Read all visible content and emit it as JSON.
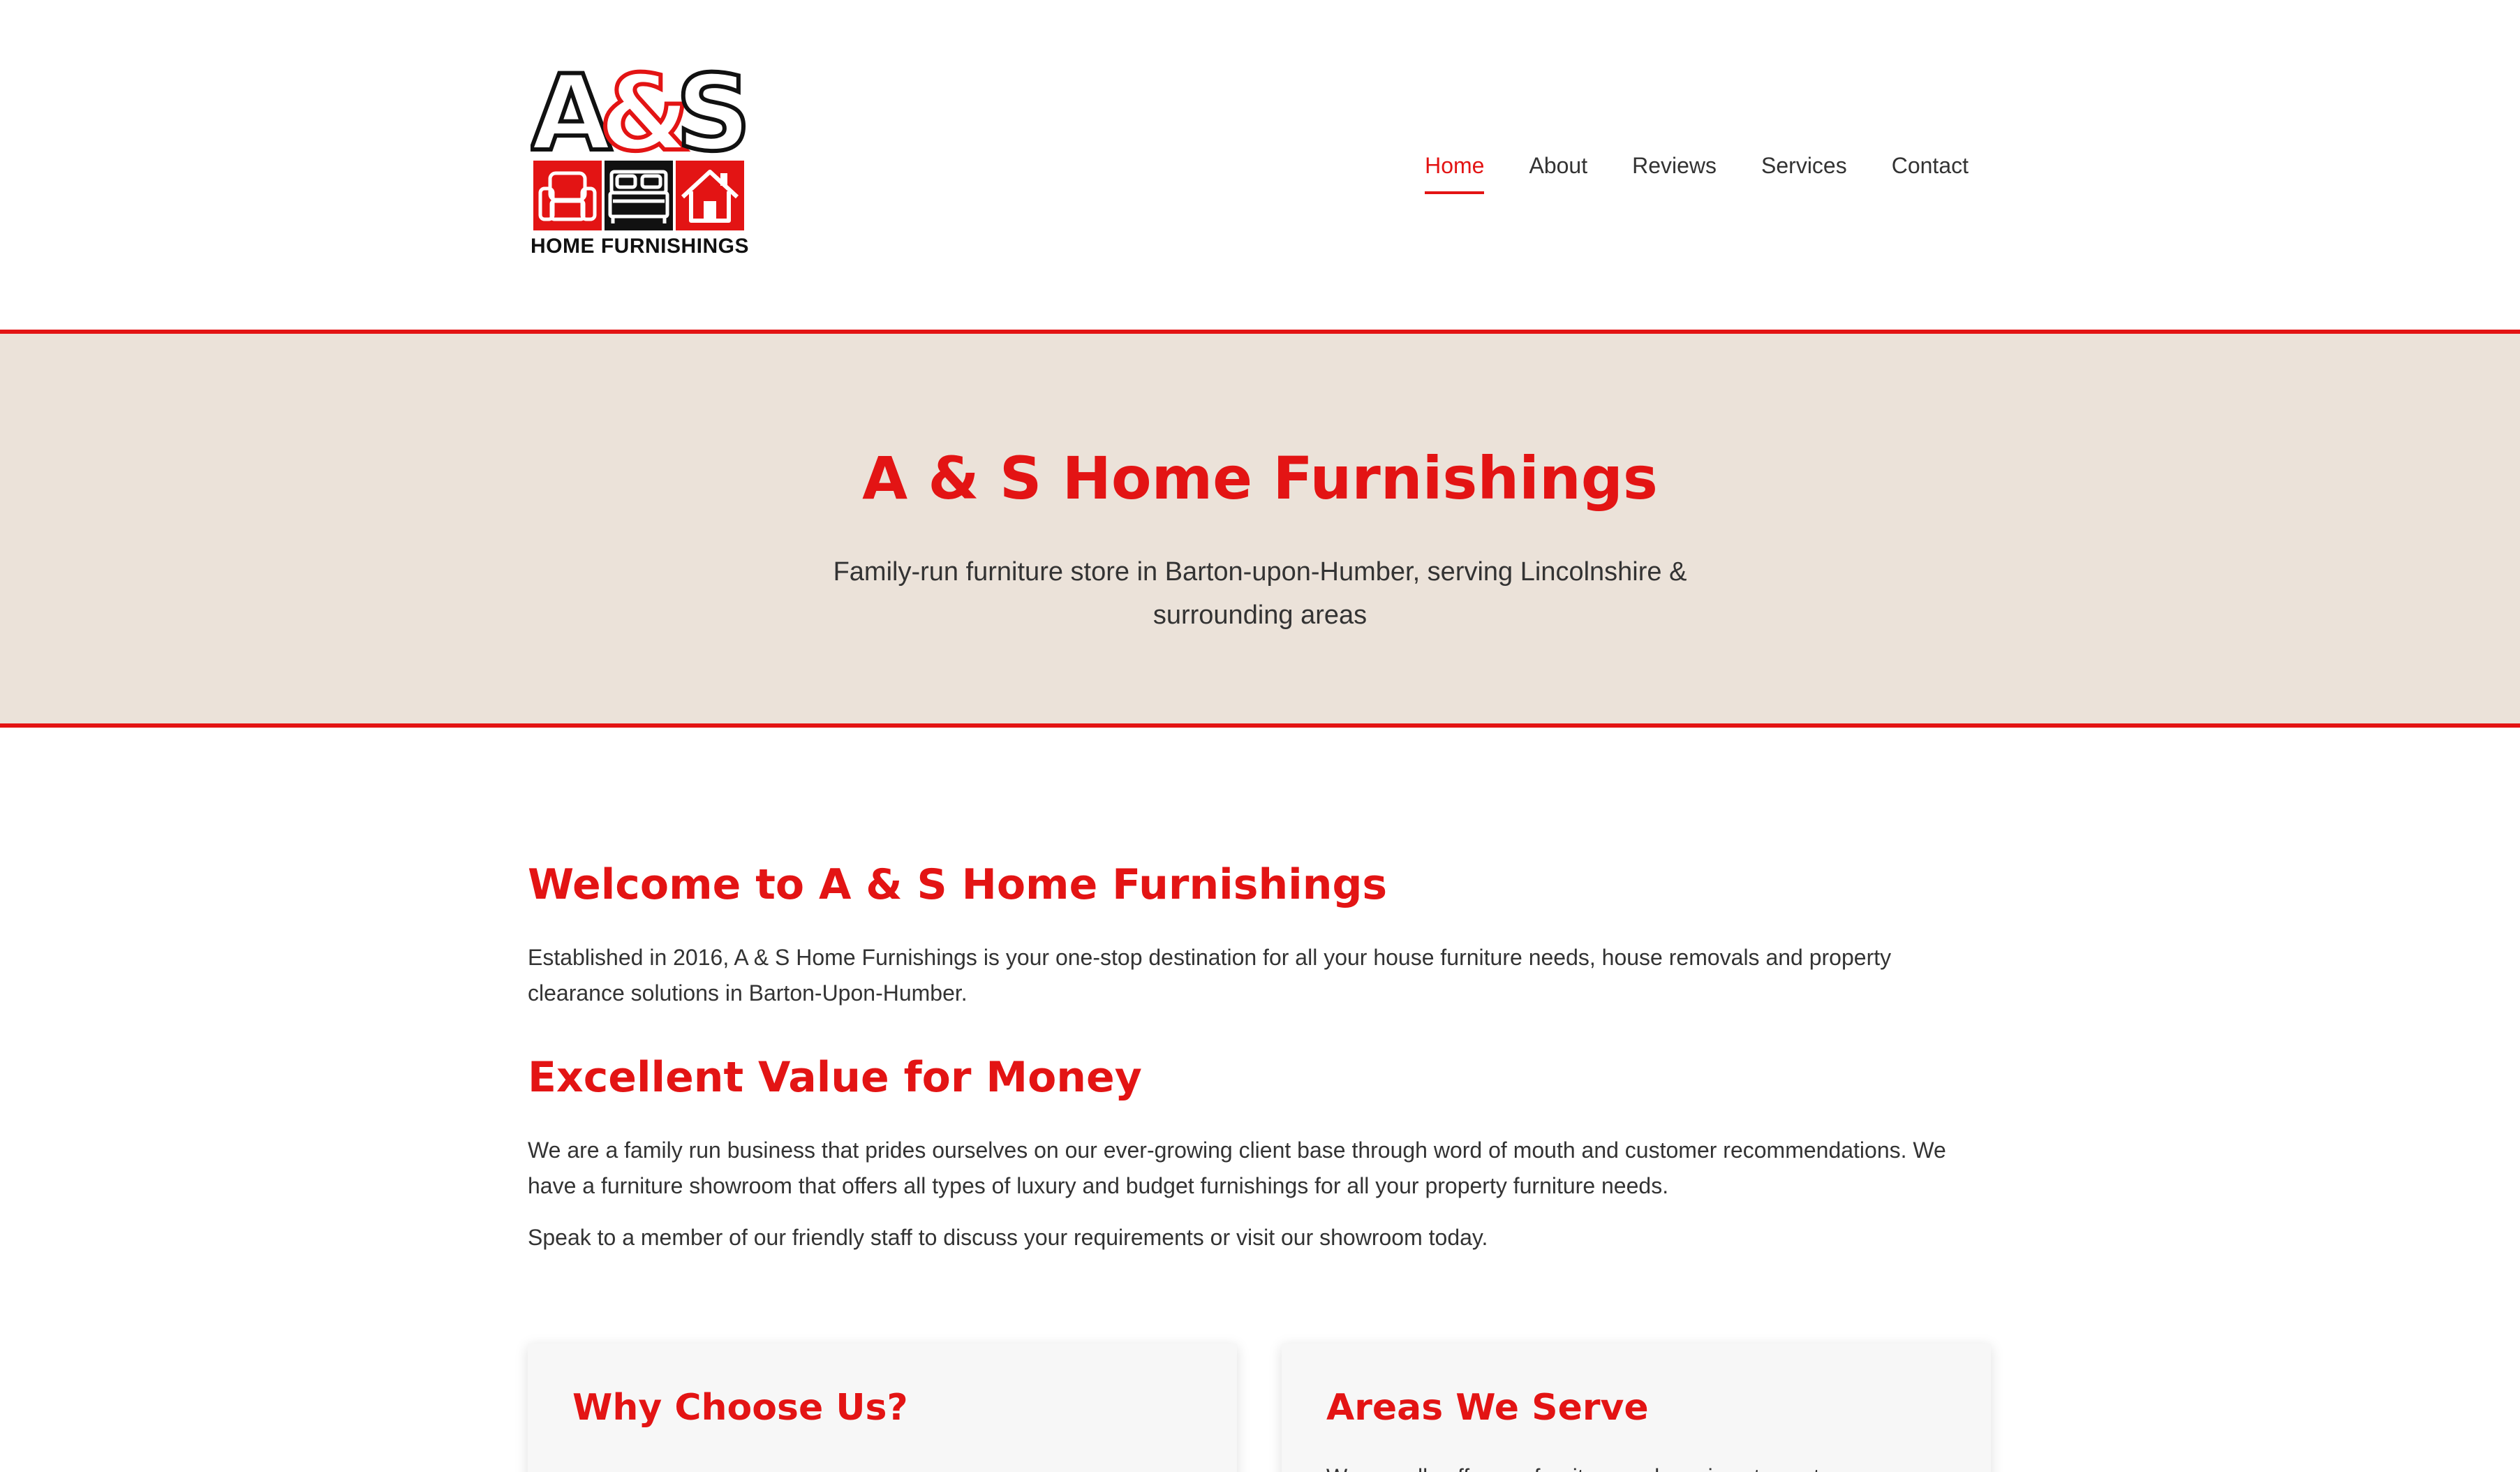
{
  "brand": {
    "logo_letters": "A&S",
    "logo_caption": "HOME FURNISHINGS",
    "colors": {
      "primary_red": "#e31414",
      "black": "#111111",
      "hero_bg": "#ebe2d9",
      "text": "#333333"
    },
    "logo_icons": [
      "armchair-icon",
      "bed-icon",
      "house-icon"
    ]
  },
  "nav": {
    "items": [
      {
        "label": "Home",
        "active": true
      },
      {
        "label": "About",
        "active": false
      },
      {
        "label": "Reviews",
        "active": false
      },
      {
        "label": "Services",
        "active": false
      },
      {
        "label": "Contact",
        "active": false
      }
    ]
  },
  "hero": {
    "title": "A & S Home Furnishings",
    "subtitle": "Family-run furniture store in Barton-upon-Humber, serving Lincolnshire & surrounding areas"
  },
  "main": {
    "welcome_heading": "Welcome to A & S Home Furnishings",
    "welcome_text": "Established in 2016, A & S Home Furnishings is your one-stop destination for all your house furniture needs, house removals and property clearance solutions in Barton-Upon-Humber.",
    "value_heading": "Excellent Value for Money",
    "value_text_1": "We are a family run business that prides ourselves on our ever-growing client base through word of mouth and customer recommendations. We have a furniture showroom that offers all types of luxury and budget furnishings for all your property furniture needs.",
    "value_text_2": "Speak to a member of our friendly staff to discuss your requirements or visit our showroom today."
  },
  "cards": {
    "why_title": "Why Choose Us?",
    "areas_title": "Areas We Serve",
    "areas_text": "We proudly offer our furniture and services to customers"
  }
}
